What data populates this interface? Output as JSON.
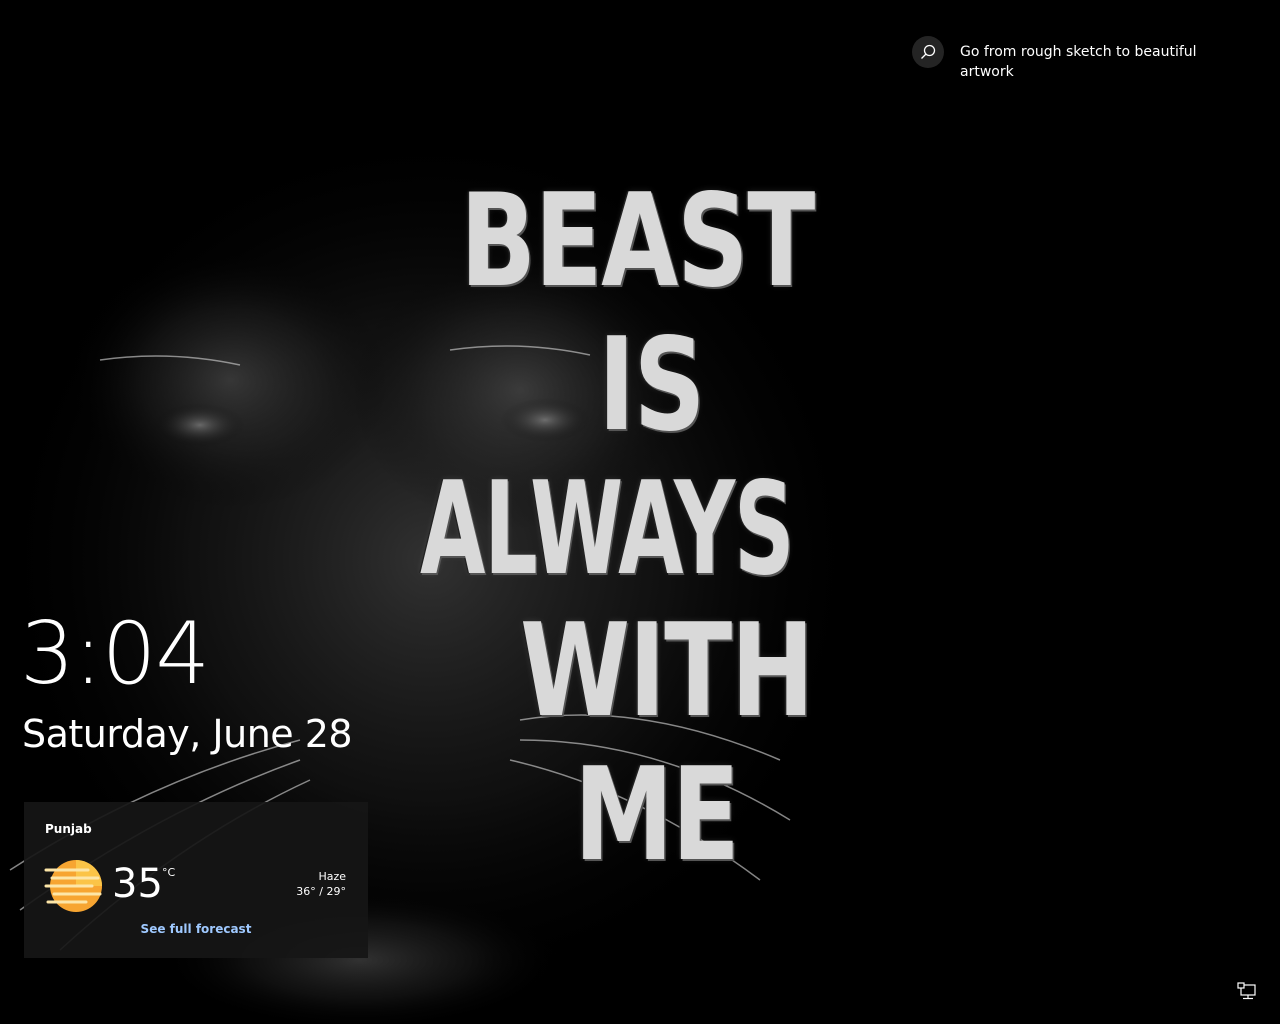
{
  "wallpaper": {
    "lines": [
      "BEAST",
      "IS",
      "ALWAYS",
      "WITH",
      "ME"
    ]
  },
  "spotlight": {
    "icon": "search-icon",
    "text": "Go from rough sketch to beautiful artwork"
  },
  "lockscreen": {
    "time": "3:04",
    "date": "Saturday, June 28"
  },
  "weather": {
    "location": "Punjab",
    "icon": "haze-sun-icon",
    "temperature": "35",
    "unit": "°C",
    "condition": "Haze",
    "range": "36° / 29°",
    "link": "See full forecast",
    "icon_colors": [
      "#f7a531",
      "#fbc447"
    ]
  },
  "system_tray": {
    "network_icon": "network-icon"
  }
}
